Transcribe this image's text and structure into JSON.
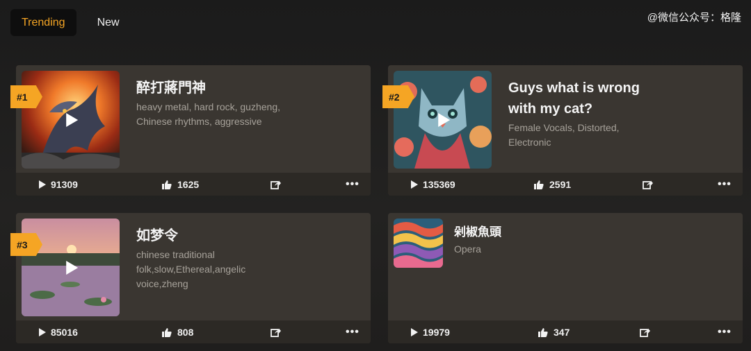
{
  "tabs": [
    {
      "label": "Trending",
      "active": true
    },
    {
      "label": "New",
      "active": false
    }
  ],
  "watermark": "@微信公众号：格隆",
  "cards": [
    {
      "rank": "#1",
      "title": "醉打蔣門神",
      "tags": "heavy metal, hard rock, guzheng, Chinese rhythms, aggressive",
      "plays": "91309",
      "likes": "1625",
      "art": "dragon-fire-art"
    },
    {
      "rank": "#2",
      "title": "Guys what is wrong with my cat?",
      "tags": "Female Vocals, Distorted, Electronic",
      "plays": "135369",
      "likes": "2591",
      "art": "psychedelic-cat-art"
    },
    {
      "rank": "#3",
      "title": "如梦令",
      "tags": "chinese traditional folk,slow,Ethereal,angelic voice,zheng",
      "plays": "85016",
      "likes": "808",
      "art": "lotus-pond-sunset-art"
    },
    {
      "rank": "",
      "title": "剁椒魚頭",
      "tags": "Opera",
      "plays": "19979",
      "likes": "347",
      "art": "colorful-waves-art"
    }
  ],
  "colors": {
    "accent": "#f5a524",
    "card": "#3a3631",
    "footer": "#2c2925"
  },
  "icons": [
    "play-icon",
    "thumbs-up-icon",
    "share-icon",
    "more-icon"
  ]
}
